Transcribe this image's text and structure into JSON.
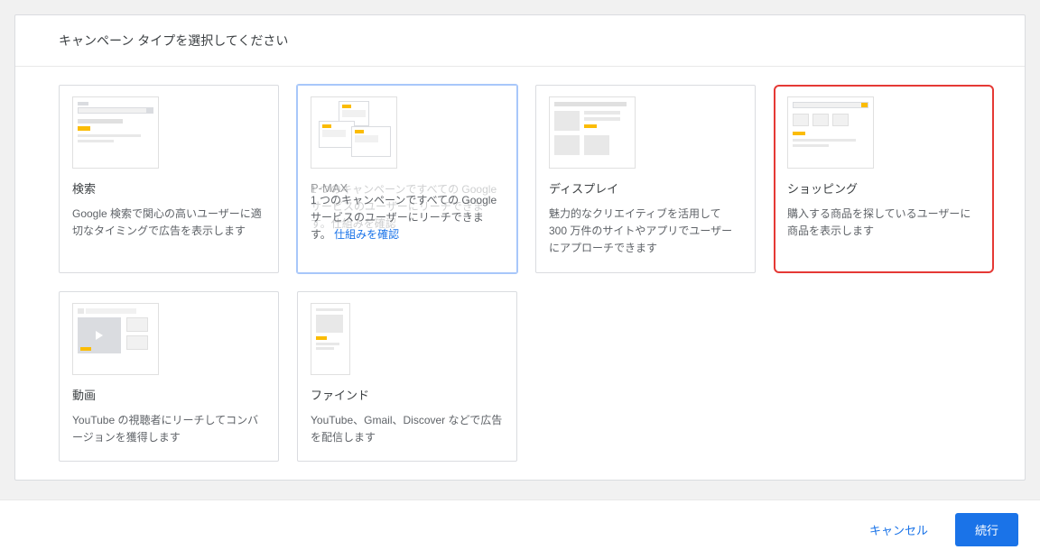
{
  "header": {
    "title": "キャンペーン タイプを選択してください"
  },
  "cards": {
    "search": {
      "title": "検索",
      "desc": "Google 検索で関心の高いユーザーに適切なタイミングで広告を表示します"
    },
    "pmax": {
      "title": "P-MAX",
      "desc": "1 つのキャンペーンですべての Google サービスのユーザーにリーチできます。",
      "ghost_text": "1 つのキャンペーンですべての Google サービスのユーザーにリーチできます。仕組みを確認",
      "link": "仕組みを確認"
    },
    "display": {
      "title": "ディスプレイ",
      "desc": "魅力的なクリエイティブを活用して 300 万件のサイトやアプリでユーザーにアプローチできます"
    },
    "shopping": {
      "title": "ショッピング",
      "desc": "購入する商品を探しているユーザーに商品を表示します"
    },
    "video": {
      "title": "動画",
      "desc": "YouTube の視聴者にリーチしてコンバージョンを獲得します"
    },
    "find": {
      "title": "ファインド",
      "desc": "YouTube、Gmail、Discover などで広告を配信します"
    }
  },
  "footer": {
    "cancel": "キャンセル",
    "continue": "続行"
  }
}
